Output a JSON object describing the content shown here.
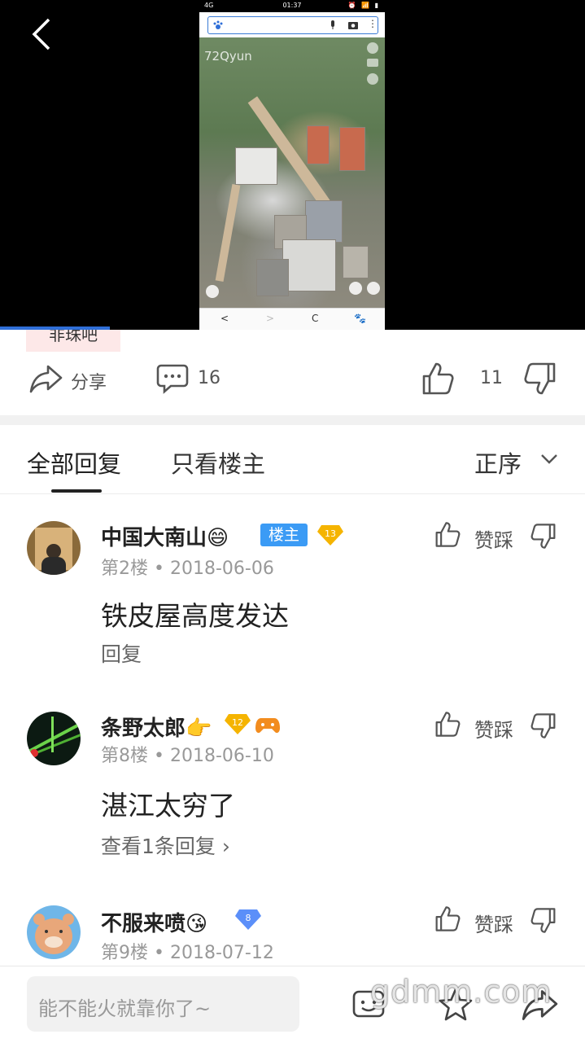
{
  "media": {
    "phone_status": {
      "left": "4G",
      "time": "01:37",
      "right": "⏰ 📶 ▮"
    },
    "phone_overlay_text": "72Qyun",
    "phone_nav": [
      "<",
      ">",
      "C",
      "🐾"
    ]
  },
  "post": {
    "tieba_tag": "非珠吧",
    "share_label": "分享",
    "comment_count": "16",
    "like_count": "11"
  },
  "tabs": {
    "all": "全部回复",
    "owner_only": "只看楼主",
    "sort": "正序"
  },
  "comments": [
    {
      "username": "中国大南山😄",
      "badge": "楼主",
      "level": "13",
      "floor_date": "第2楼 • 2018-06-06",
      "text": "铁皮屋高度发达",
      "sub_action": "回复",
      "zancai": "赞踩"
    },
    {
      "username": "条野太郎👉",
      "level": "12",
      "floor_date": "第8楼 • 2018-06-10",
      "text": "湛江太穷了",
      "sub_action": "查看1条回复 ›",
      "zancai": "赞踩"
    },
    {
      "username": "不服来喷😘",
      "level": "8",
      "floor_date": "第9楼 • 2018-07-12",
      "zancai": "赞踩"
    }
  ],
  "bottom": {
    "input_placeholder": "能不能火就靠你了~",
    "watermark": "gdmm.com"
  },
  "colors": {
    "accent_blue": "#3b9bf5",
    "level_gold": "#f5b400",
    "level_blue": "#5b8ff9",
    "tag_bg": "#fde8e8"
  }
}
